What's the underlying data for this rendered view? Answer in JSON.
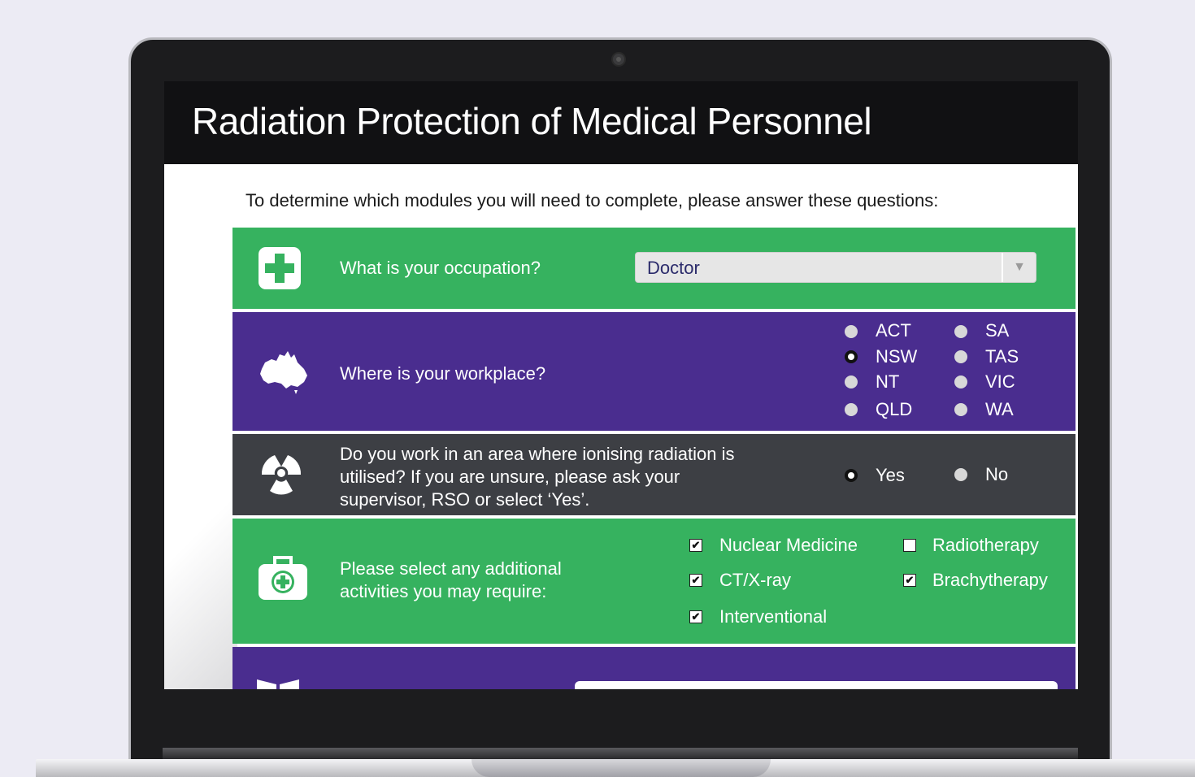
{
  "title": "Radiation Protection of Medical Personnel",
  "intro": "To determine which modules you will need to complete, please answer these questions:",
  "occupation": {
    "icon": "medical-cross-icon",
    "question": "What is your occupation?",
    "selected": "Doctor",
    "arrow": "▼"
  },
  "workplace": {
    "icon": "australia-map-icon",
    "question": "Where is your workplace?",
    "options": [
      {
        "label": "ACT",
        "checked": false
      },
      {
        "label": "NSW",
        "checked": true
      },
      {
        "label": "NT",
        "checked": false
      },
      {
        "label": "QLD",
        "checked": false
      },
      {
        "label": "SA",
        "checked": false
      },
      {
        "label": "TAS",
        "checked": false
      },
      {
        "label": "VIC",
        "checked": false
      },
      {
        "label": "WA",
        "checked": false
      }
    ]
  },
  "radiation": {
    "icon": "radiation-icon",
    "question_lines": [
      "Do you work in an area where ionising radiation is",
      "utilised? If you are unsure, please ask your",
      "supervisor, RSO or select ‘Yes’."
    ],
    "options": [
      {
        "label": "Yes",
        "checked": true
      },
      {
        "label": "No",
        "checked": false
      }
    ]
  },
  "activities": {
    "icon": "first-aid-kit-icon",
    "question_lines": [
      "Please select any additional",
      "activities you may require:"
    ],
    "options": [
      {
        "label": "Nuclear Medicine",
        "checked": true
      },
      {
        "label": "CT/X-ray",
        "checked": true
      },
      {
        "label": "Interventional",
        "checked": true
      },
      {
        "label": "Radiotherapy",
        "checked": false
      },
      {
        "label": "Brachytherapy",
        "checked": true
      }
    ]
  },
  "colors": {
    "green": "#36b25f",
    "purple": "#4a2d8f",
    "dark": "#3d3f44",
    "titlebar": "#111113"
  }
}
